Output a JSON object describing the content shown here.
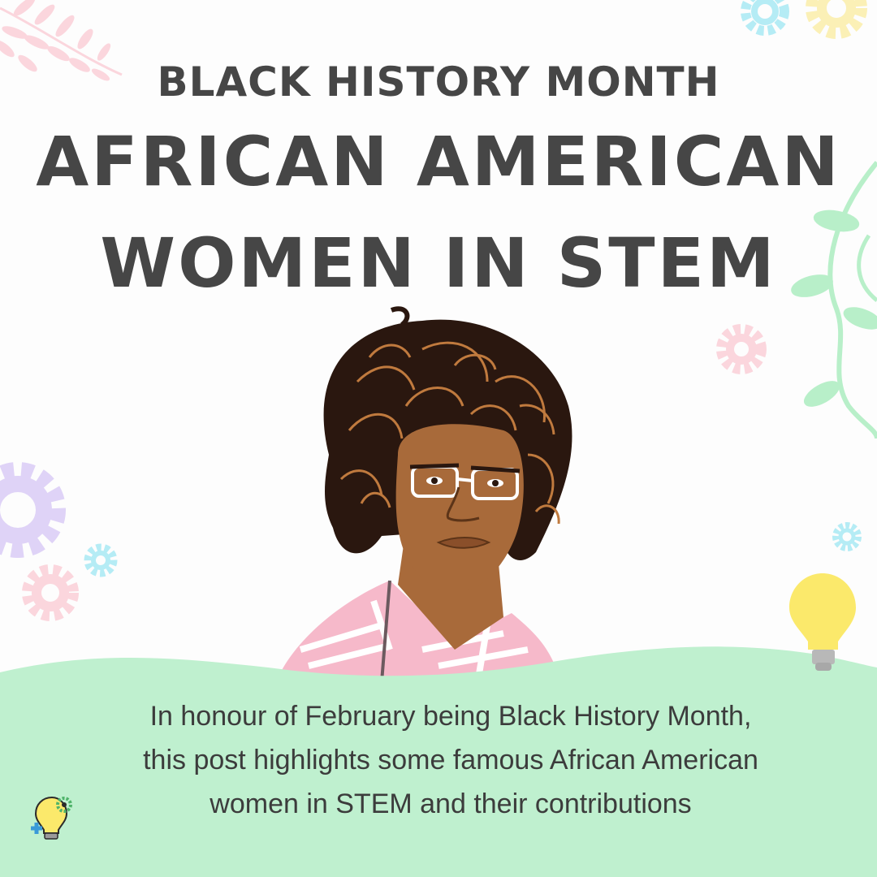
{
  "header": {
    "line1": "BLACK HISTORY MONTH",
    "line2": "AFRICAN AMERICAN",
    "line3": "WOMEN IN STEM"
  },
  "description": {
    "line1": "In honour of February being Black History Month,",
    "line2": "this post highlights some famous African American",
    "line3": "women in STEM and their contributions"
  },
  "colors": {
    "title_text": "#464646",
    "hill_green": "#bff0cf",
    "skin": "#a86a3a",
    "hair_dark": "#2a170f",
    "hair_line": "#c07a3e",
    "shirt_pink": "#f6b9ca",
    "bulb_yellow": "#fbe96b",
    "gear_pink": "#fbd6dd",
    "gear_purple": "#dfd3f7",
    "gear_blue": "#b5ecf5",
    "gear_yellow": "#fbf0b6",
    "vine_green": "#b8efc9"
  },
  "icons": [
    "fern-leaf-icon",
    "gear-icon",
    "vine-icon",
    "lightbulb-icon",
    "logo-lightbulb-gear-icon"
  ]
}
